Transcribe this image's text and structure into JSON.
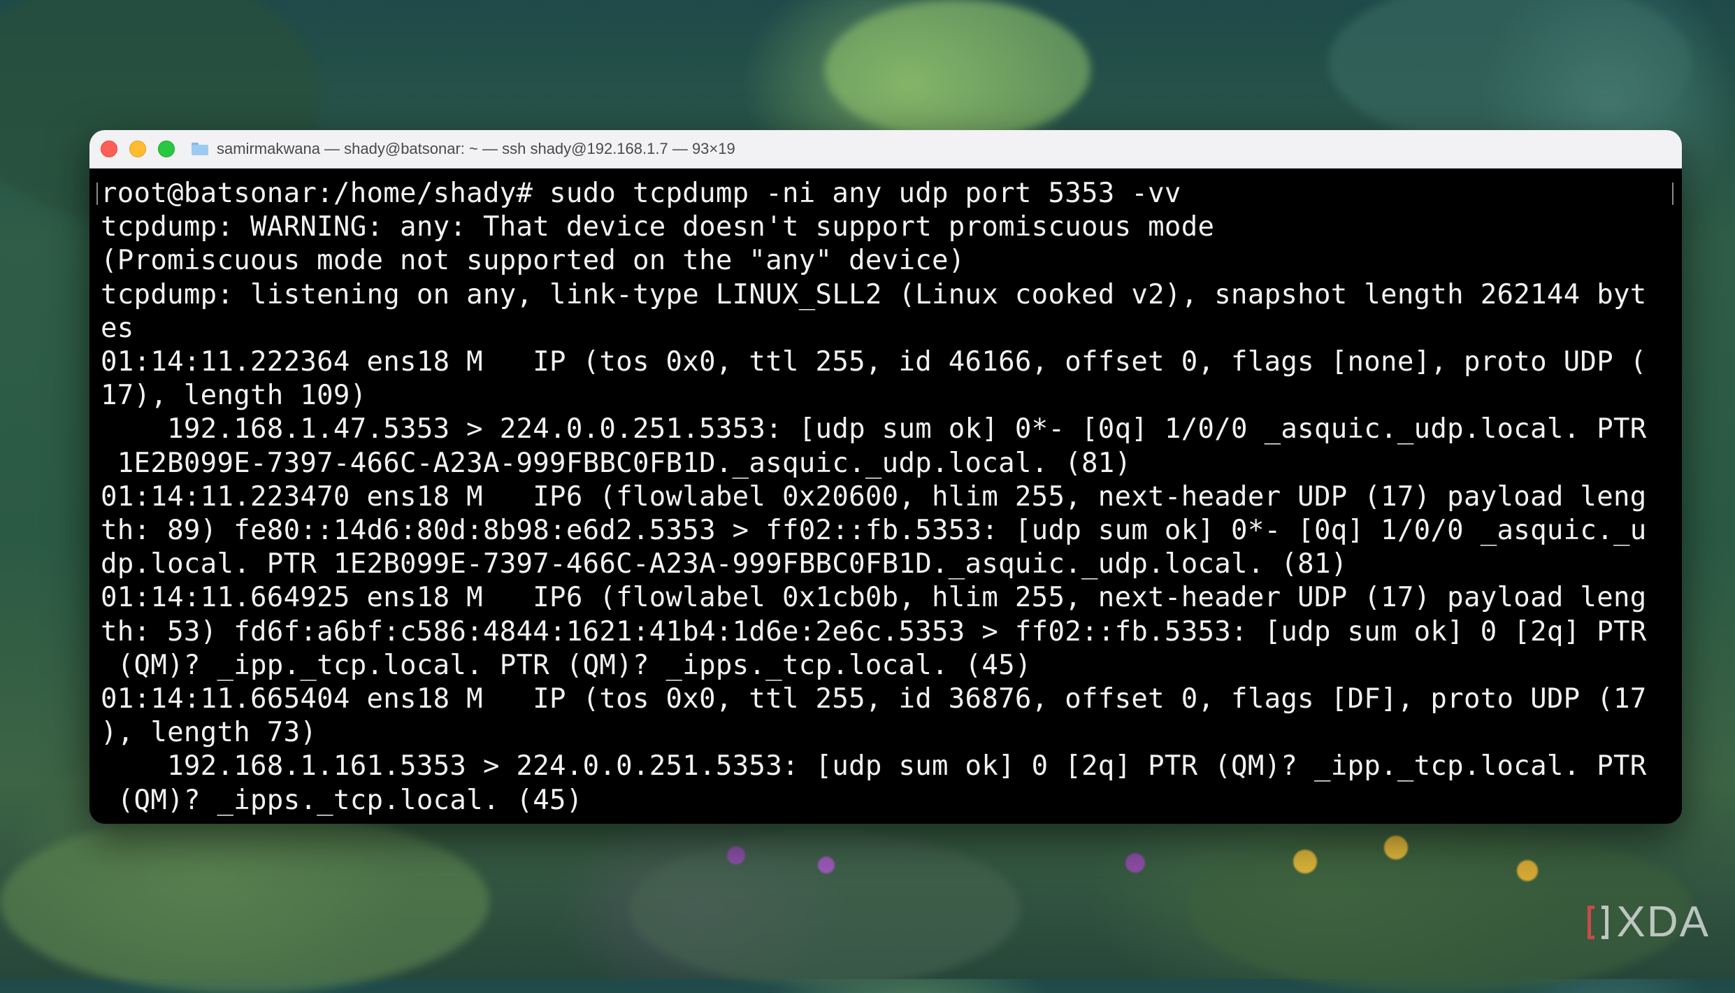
{
  "window": {
    "title": "samirmakwana — shady@batsonar: ~ — ssh shady@192.168.1.7 — 93×19",
    "controls": [
      "close",
      "minimize",
      "zoom"
    ],
    "folder_icon": "folder-icon"
  },
  "terminal": {
    "lines": [
      "root@batsonar:/home/shady# sudo tcpdump -ni any udp port 5353 -vv",
      "tcpdump: WARNING: any: That device doesn't support promiscuous mode",
      "(Promiscuous mode not supported on the \"any\" device)",
      "tcpdump: listening on any, link-type LINUX_SLL2 (Linux cooked v2), snapshot length 262144 byt",
      "es",
      "01:14:11.222364 ens18 M   IP (tos 0x0, ttl 255, id 46166, offset 0, flags [none], proto UDP (",
      "17), length 109)",
      "    192.168.1.47.5353 > 224.0.0.251.5353: [udp sum ok] 0*- [0q] 1/0/0 _asquic._udp.local. PTR",
      " 1E2B099E-7397-466C-A23A-999FBBC0FB1D._asquic._udp.local. (81)",
      "01:14:11.223470 ens18 M   IP6 (flowlabel 0x20600, hlim 255, next-header UDP (17) payload leng",
      "th: 89) fe80::14d6:80d:8b98:e6d2.5353 > ff02::fb.5353: [udp sum ok] 0*- [0q] 1/0/0 _asquic._u",
      "dp.local. PTR 1E2B099E-7397-466C-A23A-999FBBC0FB1D._asquic._udp.local. (81)",
      "01:14:11.664925 ens18 M   IP6 (flowlabel 0x1cb0b, hlim 255, next-header UDP (17) payload leng",
      "th: 53) fd6f:a6bf:c586:4844:1621:41b4:1d6e:2e6c.5353 > ff02::fb.5353: [udp sum ok] 0 [2q] PTR",
      " (QM)? _ipp._tcp.local. PTR (QM)? _ipps._tcp.local. (45)",
      "01:14:11.665404 ens18 M   IP (tos 0x0, ttl 255, id 36876, offset 0, flags [DF], proto UDP (17",
      "), length 73)",
      "    192.168.1.161.5353 > 224.0.0.251.5353: [udp sum ok] 0 [2q] PTR (QM)? _ipp._tcp.local. PTR",
      " (QM)? _ipps._tcp.local. (45)"
    ]
  },
  "watermark": {
    "text": "XDA",
    "accent": "#c94a4a"
  }
}
